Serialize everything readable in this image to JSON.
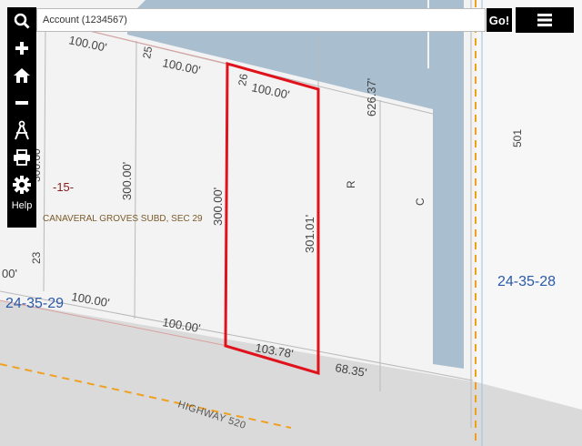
{
  "search": {
    "placeholder": "Account (1234567)"
  },
  "buttons": {
    "go_label": "Go!",
    "help_label": "Help"
  },
  "toolbar": {
    "icons": [
      "search-icon",
      "zoom-in-icon",
      "home-icon",
      "zoom-out-icon",
      "measure-icon",
      "print-icon",
      "settings-icon"
    ]
  },
  "menu": {
    "icon": "hamburger-menu-icon"
  },
  "map": {
    "section_label": "-15-",
    "subdivision_label": "CANAVERAL GROVES SUBD, SEC 29",
    "section_left": "24-35-29",
    "section_right": "24-35-28",
    "road_name": "HIGHWAY 520",
    "lot_numbers": [
      "25",
      "26",
      "23"
    ],
    "parcel_codes": [
      "R",
      "C",
      "501"
    ],
    "dimensions": {
      "top_left": "100.00'",
      "top_lot25": "100.00'",
      "top_lot26": "100.00'",
      "depth_left": "300.00'",
      "depth_lot25": "300.00'",
      "depth_lot26": "301.01'",
      "side_right": "626.37'",
      "bottom_left": "100.00'",
      "bottom_lot25": "100.00'",
      "bottom_lot26": "103.78'",
      "bottom_right": "68.35'",
      "edge_left_bottom": "00'",
      "edge_left_top": "300.00"
    },
    "colors": {
      "background": "#f3f3f3",
      "road": "#dadada",
      "canal": "#a9bfd0",
      "highlight": "#e0121c",
      "section_text": "#2a5aa8",
      "subdivision_text": "#7b5a2a",
      "section_label_text": "#8b1a1a",
      "dashed_line": "#f0a020",
      "parcel_line": "#b9b9b9"
    }
  }
}
